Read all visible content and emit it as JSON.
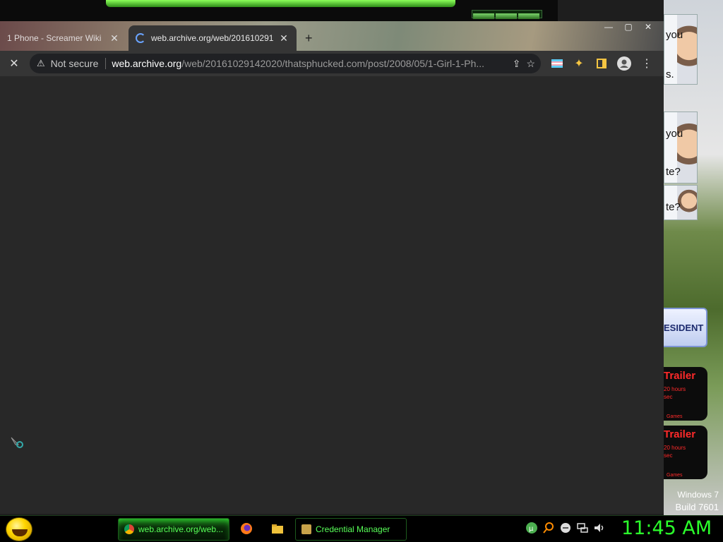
{
  "desktop": {
    "cards": [
      {
        "text": "you"
      },
      {
        "text": "s."
      },
      {
        "text": "you"
      },
      {
        "text": "te?"
      },
      {
        "text": "te?"
      }
    ],
    "president_text": "ESIDENT",
    "trailers": [
      {
        "title": "Trailer",
        "line1": "20 hours",
        "line2": "sec",
        "category": "Games"
      },
      {
        "title": "Trailer",
        "line1": "20 hours",
        "line2": "sec",
        "category": "Games"
      }
    ],
    "windows_label": "Windows 7",
    "build_label": "Build 7601"
  },
  "browser": {
    "tabs": [
      {
        "title": "1 Phone - Screamer Wiki",
        "active": false
      },
      {
        "title": "web.archive.org/web/201610291",
        "active": true
      }
    ],
    "new_tab_label": "+",
    "window_controls": [
      "—",
      "▢",
      "✕"
    ],
    "toolbar": {
      "stop_label": "✕",
      "security_text": "Not secure",
      "url_host": "web.archive.org",
      "url_path": "/web/20161029142020/thatsphucked.com/post/2008/05/1-Girl-1-Ph..."
    }
  },
  "taskbar": {
    "tasks": [
      {
        "label": "web.archive.org/web...",
        "active": true
      },
      {
        "label": "Credential Manager",
        "active": false
      }
    ],
    "clock": "11:45 AM"
  },
  "colors": {
    "accent_green": "#2bff2b",
    "browser_bg": "#282828"
  }
}
